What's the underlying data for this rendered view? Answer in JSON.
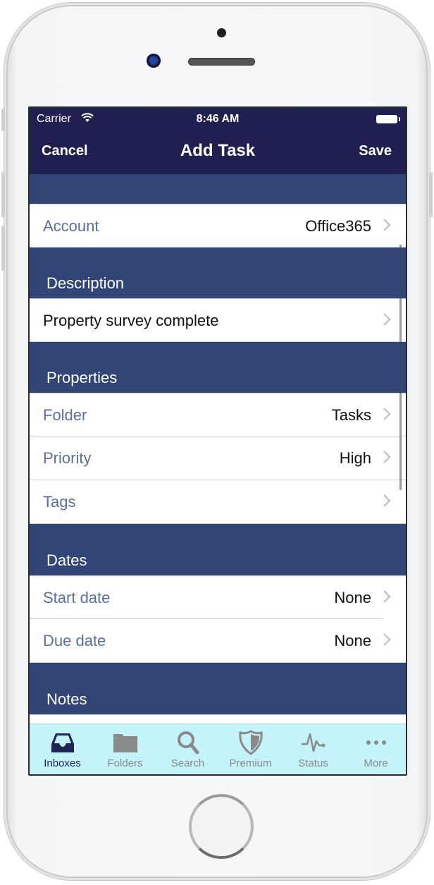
{
  "status_bar": {
    "carrier": "Carrier",
    "wifi_icon": "wifi-icon",
    "time": "8:46 AM",
    "battery_icon": "battery-icon"
  },
  "nav": {
    "cancel_label": "Cancel",
    "title": "Add Task",
    "save_label": "Save"
  },
  "sections": {
    "account": {
      "header": "",
      "rows": [
        {
          "label": "Account",
          "value": "Office365"
        }
      ]
    },
    "description": {
      "header": "Description",
      "rows": [
        {
          "label": "Property survey complete",
          "value": ""
        }
      ]
    },
    "properties": {
      "header": "Properties",
      "rows": [
        {
          "label": "Folder",
          "value": "Tasks"
        },
        {
          "label": "Priority",
          "value": "High"
        },
        {
          "label": "Tags",
          "value": ""
        }
      ]
    },
    "dates": {
      "header": "Dates",
      "rows": [
        {
          "label": "Start date",
          "value": "None"
        },
        {
          "label": "Due date",
          "value": "None"
        }
      ]
    },
    "notes": {
      "header": "Notes"
    }
  },
  "tab_bar": {
    "active": "Inboxes",
    "tabs": [
      {
        "label": "Inboxes",
        "icon": "inbox-tray-icon"
      },
      {
        "label": "Folders",
        "icon": "folder-icon"
      },
      {
        "label": "Search",
        "icon": "search-icon"
      },
      {
        "label": "Premium",
        "icon": "shield-icon"
      },
      {
        "label": "Status",
        "icon": "pulse-icon"
      },
      {
        "label": "More",
        "icon": "more-dots-icon"
      }
    ]
  },
  "colors": {
    "nav_background": "#1f2050",
    "section_background": "#314677",
    "row_label": "#5a6f9c",
    "tab_bar_background": "#c4f3fc",
    "tab_active": "#1e2454",
    "tab_inactive": "#8a8a8a"
  }
}
